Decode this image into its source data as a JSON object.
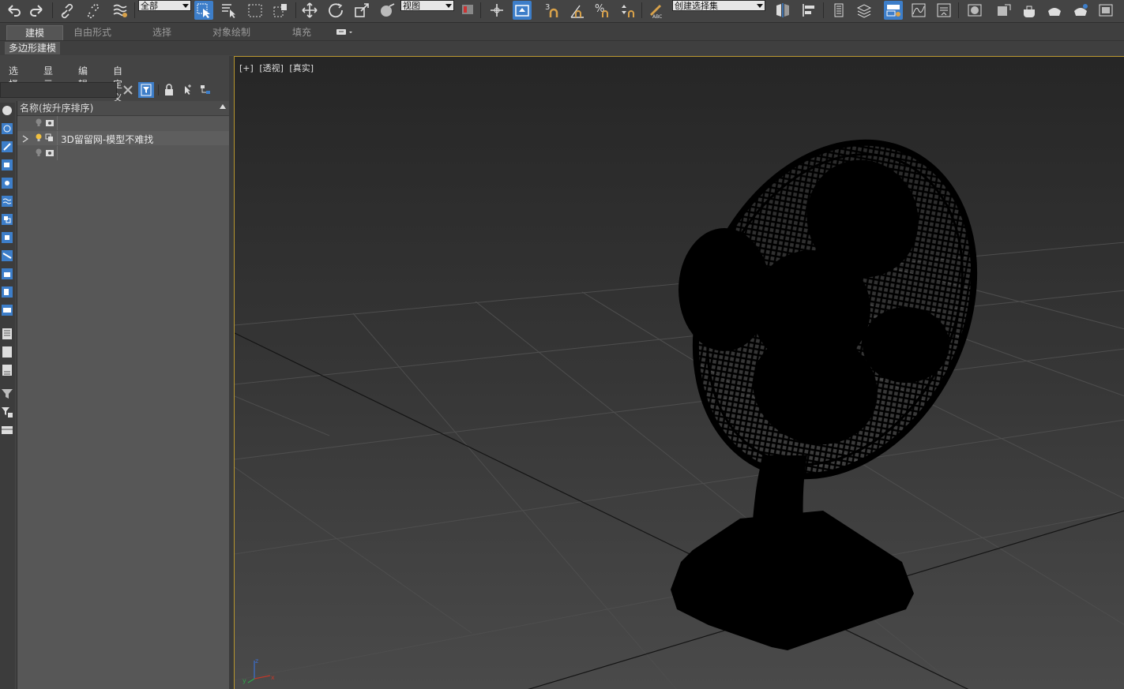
{
  "toolbar": {
    "selection_filter": "全部",
    "reference_coord": "视图",
    "named_selection": "创建选择集"
  },
  "ribbon": {
    "tabs": [
      "建模",
      "自由形式",
      "选择",
      "对象绘制",
      "填充"
    ],
    "active_tab": "建模",
    "sub_label": "多边形建模"
  },
  "explorer": {
    "menu": [
      "选择",
      "显示",
      "编辑",
      "自定义"
    ],
    "search_placeholder": "",
    "list_header": "名称(按升序排序)",
    "rows": [
      {
        "label": ""
      },
      {
        "label": "3D留留网-模型不难找"
      },
      {
        "label": ""
      }
    ]
  },
  "viewport": {
    "labels": [
      "[+]",
      "[透视]",
      "[真实]"
    ],
    "axis": {
      "x": "x",
      "y": "y",
      "z": "z"
    }
  },
  "colors": {
    "accent": "#3d7ec9",
    "viewport_border": "#b8962e",
    "panel_bg": "#444444"
  }
}
